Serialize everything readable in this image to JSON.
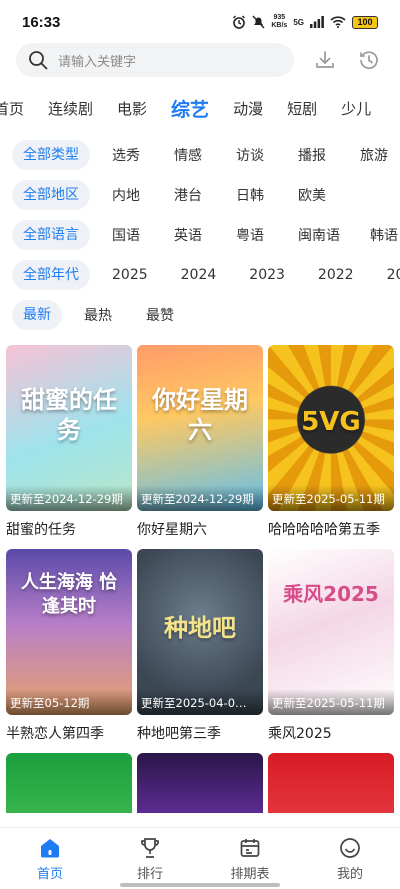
{
  "status_bar": {
    "time": "16:33",
    "net_speed_value": "935",
    "net_speed_unit": "KB/s",
    "network": "5G",
    "battery": "100"
  },
  "search": {
    "placeholder": "请输入关键字"
  },
  "tabs": [
    {
      "label": "首页"
    },
    {
      "label": "连续剧"
    },
    {
      "label": "电影"
    },
    {
      "label": "综艺",
      "active": true
    },
    {
      "label": "动漫"
    },
    {
      "label": "短剧"
    },
    {
      "label": "少儿"
    }
  ],
  "filters": {
    "type": {
      "selected": "全部类型",
      "options": [
        "选秀",
        "情感",
        "访谈",
        "播报",
        "旅游"
      ]
    },
    "region": {
      "selected": "全部地区",
      "options": [
        "内地",
        "港台",
        "日韩",
        "欧美"
      ]
    },
    "language": {
      "selected": "全部语言",
      "options": [
        "国语",
        "英语",
        "粤语",
        "闽南语",
        "韩语"
      ]
    },
    "year": {
      "selected": "全部年代",
      "options": [
        "2025",
        "2024",
        "2023",
        "2022",
        "20"
      ]
    },
    "sort": {
      "selected": "最新",
      "options": [
        "最热",
        "最赞"
      ]
    }
  },
  "shows": [
    {
      "title": "甜蜜的任务",
      "update": "更新至2024-12-29期",
      "poster_text": "甜蜜的任务"
    },
    {
      "title": "你好星期六",
      "update": "更新至2024-12-29期",
      "poster_text": "你好星期六"
    },
    {
      "title": "哈哈哈哈哈第五季",
      "update": "更新至2025-05-11期",
      "poster_text": "5VG"
    },
    {
      "title": "半熟恋人第四季",
      "update": "更新至05-12期",
      "poster_text": "人生海海 恰逢其时"
    },
    {
      "title": "种地吧第三季",
      "update": "更新至2025-04-0…",
      "poster_text": "种地吧"
    },
    {
      "title": "乘风2025",
      "update": "更新至2025-05-11期",
      "poster_text": "乘风2025"
    }
  ],
  "bottom_nav": [
    {
      "label": "首页",
      "icon": "home-icon",
      "active": true
    },
    {
      "label": "排行",
      "icon": "trophy-icon"
    },
    {
      "label": "排期表",
      "icon": "calendar-icon"
    },
    {
      "label": "我的",
      "icon": "profile-icon"
    }
  ],
  "colors": {
    "accent": "#1e7cf2"
  }
}
